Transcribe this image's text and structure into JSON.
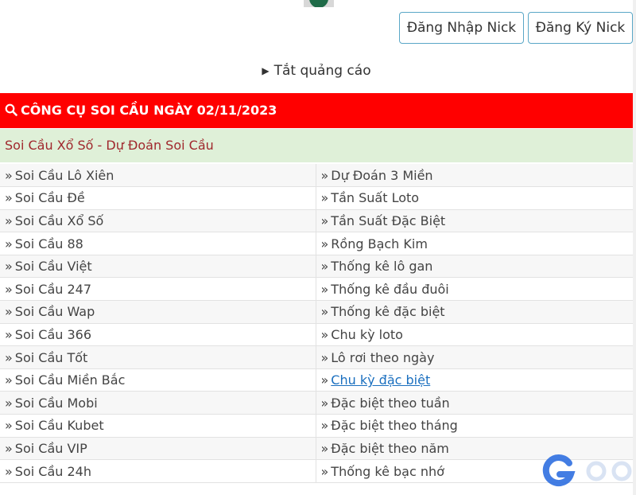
{
  "auth": {
    "login_label": "Đăng Nhập Nick",
    "register_label": "Đăng Ký Nick"
  },
  "ad_toggle": {
    "label": "Tắt quảng cáo"
  },
  "tool": {
    "header": "CÔNG CỤ SOI CẦU NGÀY 02/11/2023",
    "subheader": "Soi Cầu Xổ Số - Dự Đoán Soi Cầu"
  },
  "links": {
    "left": [
      "Soi Cầu Lô Xiên",
      "Soi Cầu Đề",
      "Soi Cầu Xổ Số",
      "Soi Cầu 88",
      "Soi Cầu Việt",
      "Soi Cầu 247",
      "Soi Cầu Wap",
      "Soi Cầu 366",
      "Soi Cầu Tốt",
      "Soi Cầu Miền Bắc",
      "Soi Cầu Mobi",
      "Soi Cầu Kubet",
      "Soi Cầu VIP",
      "Soi Cầu 24h"
    ],
    "right": [
      "Dự Đoán 3 Miền",
      "Tần Suất Loto",
      "Tần Suất Đặc Biệt",
      "Rồng Bạch Kim",
      "Thống kê lô gan",
      "Thống kê đầu đuôi",
      "Thống kê đặc biệt",
      "Chu kỳ loto",
      "Lô rơi theo ngày",
      "Chu kỳ đặc biệt",
      "Đặc biệt theo tuần",
      "Đặc biệt theo tháng",
      "Đặc biệt theo năm",
      "Thống kê bạc nhớ"
    ],
    "active_right_index": 9
  },
  "colors": {
    "header_bg": "#ff0000",
    "subheader_bg": "#dff0d8",
    "subheader_text": "#a0282d",
    "link_active": "#1a6fbf",
    "button_border": "#5aa7c7"
  },
  "icons": {
    "header_icon": "search-icon",
    "ad_toggle_icon": "play-triangle-icon",
    "watermark_icon": "brand-g-logo"
  }
}
